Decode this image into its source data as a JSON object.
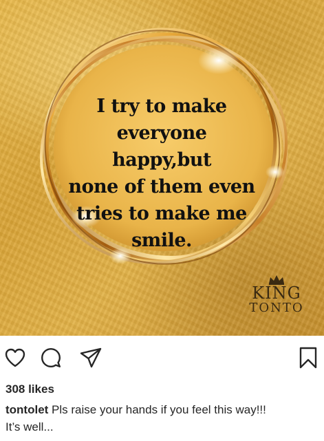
{
  "post": {
    "quote": "I try to make\neveryone happy,but\nnone of them even\ntries to make me\nsmile.",
    "brand": {
      "line1": "KING",
      "line2": "TONTO"
    },
    "crown_icon": "crown-icon"
  },
  "actions": {
    "like_icon": "heart-icon",
    "comment_icon": "comment-icon",
    "share_icon": "send-icon",
    "save_icon": "bookmark-icon"
  },
  "likes": "308 likes",
  "caption": {
    "username": "tontolet",
    "text": " Pls raise your hands if you feel this way!!!",
    "more": "It’s well..."
  },
  "colors": {
    "gold_bg": "#d9a437",
    "ring_gold": "#f0c060",
    "text_dark": "#262626"
  }
}
